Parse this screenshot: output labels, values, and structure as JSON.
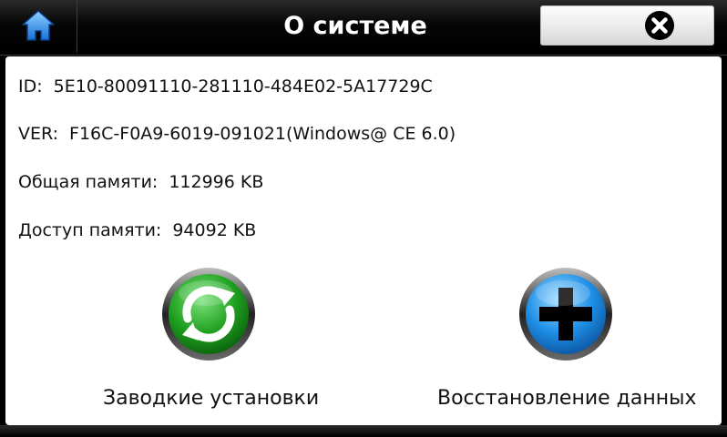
{
  "header": {
    "title": "О системе"
  },
  "info": {
    "id_label": "ID:",
    "id_value": "5E10-80091110-281110-484E02-5A17729C",
    "ver_label": "VER:",
    "ver_value": "F16C-F0A9-6019-091021(Windows@ CE 6.0)",
    "total_label": "Общая памяти:",
    "total_value": "112996 KB",
    "free_label": "Доступ памяти:",
    "free_value": "94092 KB"
  },
  "actions": {
    "factory_reset_label": "Заводкие установки",
    "restore_data_label": "Восстановление данных"
  },
  "colors": {
    "factory_reset": "#1fa01f",
    "restore_data": "#1e8fe6"
  },
  "icons": {
    "home": "home-icon",
    "close": "close-icon",
    "refresh": "refresh-icon",
    "plus": "plus-icon"
  }
}
